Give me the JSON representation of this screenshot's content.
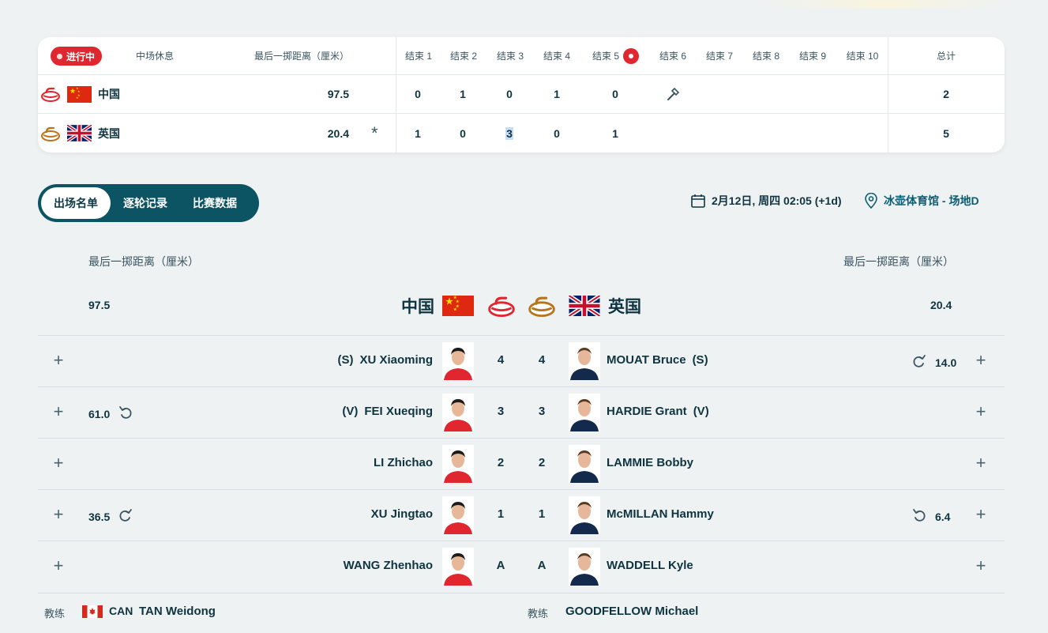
{
  "scoreboard": {
    "status_badge": "进行中",
    "break_label": "中场休息",
    "last_stone_label": "最后一掷距离（厘米）",
    "ends": [
      "结束 1",
      "结束 2",
      "结束 3",
      "结束 4",
      "结束 5",
      "结束 6",
      "结束 7",
      "结束 8",
      "结束 9",
      "结束 10"
    ],
    "total_label": "总计",
    "current_end": 5,
    "teams": [
      {
        "name": "中国",
        "stone_color": "red",
        "last_stone": "97.5",
        "scores": [
          "0",
          "1",
          "0",
          "1",
          "0"
        ],
        "total": "2",
        "hammer_end": 6
      },
      {
        "name": "英国",
        "stone_color": "yellow",
        "last_stone": "20.4",
        "scores": [
          "1",
          "0",
          "3",
          "0",
          "1"
        ],
        "total": "5",
        "marker": "*"
      }
    ]
  },
  "tabs": [
    "出场名单",
    "逐轮记录",
    "比赛数据"
  ],
  "active_tab": "出场名单",
  "match_info": {
    "datetime": "2月12日, 周四 02:05 (+1d)",
    "venue": "冰壶体育馆 - 场地D"
  },
  "lineup": {
    "dist_label_left": "最后一掷距离（厘米）",
    "dist_label_right": "最后一掷距离（厘米）",
    "left_dist": "97.5",
    "right_dist": "20.4",
    "left_team": "中国",
    "right_team": "英国",
    "players": [
      {
        "left_role": "(S)",
        "left_name": "XU Xiaoming",
        "left_pos": "4",
        "right_pos": "4",
        "right_name": "MOUAT Bruce",
        "right_role": "(S)",
        "left_stat": "",
        "right_stat": "14.0"
      },
      {
        "left_role": "(V)",
        "left_name": "FEI Xueqing",
        "left_pos": "3",
        "right_pos": "3",
        "right_name": "HARDIE Grant",
        "right_role": "(V)",
        "left_stat": "61.0",
        "right_stat": ""
      },
      {
        "left_role": "",
        "left_name": "LI Zhichao",
        "left_pos": "2",
        "right_pos": "2",
        "right_name": "LAMMIE Bobby",
        "right_role": "",
        "left_stat": "",
        "right_stat": ""
      },
      {
        "left_role": "",
        "left_name": "XU Jingtao",
        "left_pos": "1",
        "right_pos": "1",
        "right_name": "McMILLAN Hammy",
        "right_role": "",
        "left_stat": "36.5",
        "right_stat": "6.4"
      },
      {
        "left_role": "",
        "left_name": "WANG Zhenhao",
        "left_pos": "A",
        "right_pos": "A",
        "right_name": "WADDELL Kyle",
        "right_role": "",
        "left_stat": "",
        "right_stat": ""
      }
    ],
    "coach_label": "教练",
    "left_coach_country": "CAN",
    "left_coach": "TAN Weidong",
    "right_coach": "GOODFELLOW Michael"
  },
  "colors": {
    "accent": "#0c5363",
    "live": "#e0262f",
    "red_stone": "#e0262f",
    "yellow_stone": "#b8741a"
  }
}
